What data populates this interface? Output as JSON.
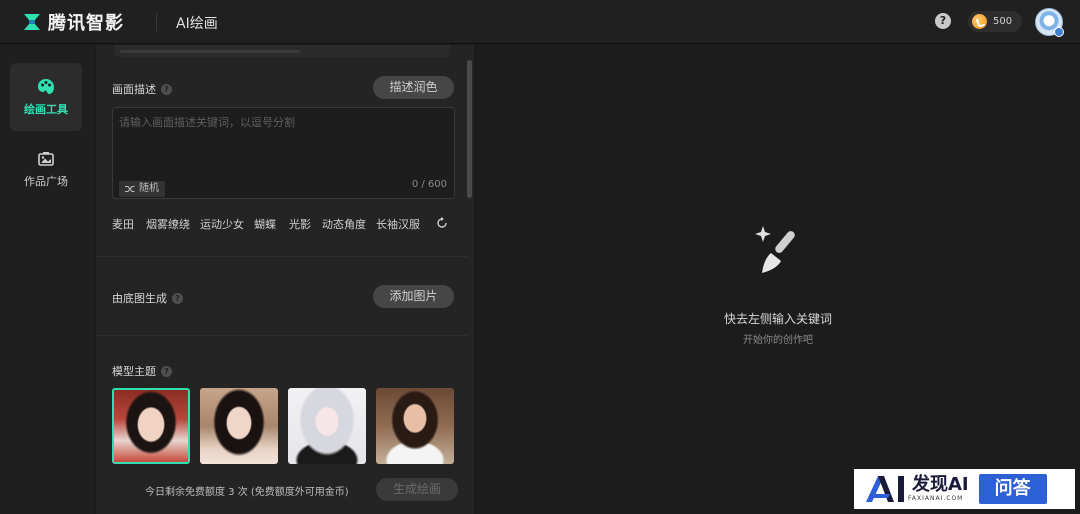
{
  "topbar": {
    "brand": "腾讯智影",
    "app_title": "AI绘画",
    "help_icon": "?",
    "coin_balance": "500",
    "icons": [
      "logo-icon",
      "help-icon",
      "coin-icon",
      "avatar"
    ]
  },
  "leftnav": {
    "items": [
      {
        "label": "绘画工具",
        "icon": "palette-icon",
        "active": true
      },
      {
        "label": "作品广场",
        "icon": "gallery-icon",
        "active": false
      }
    ]
  },
  "editor": {
    "description": {
      "label": "画面描述",
      "polish_button": "描述润色",
      "placeholder": "请输入画面描述关键词，以逗号分割",
      "random_button": "随机",
      "char_count": "0 / 600"
    },
    "tags": [
      "麦田",
      "烟雾缭绕",
      "运动少女",
      "蝴蝶",
      "光影",
      "动态角度",
      "长袖汉服"
    ],
    "base_image": {
      "label": "由底图生成",
      "add_button": "添加图片"
    },
    "model_theme": {
      "label": "模型主题",
      "thumbnails": 4,
      "selected_index": 0
    },
    "quota_text": "今日剩余免费额度 3 次 (免费额度外可用金币)",
    "generate_button": "生成绘画"
  },
  "empty_state": {
    "title": "快去左侧输入关键词",
    "subtitle": "开始你的创作吧"
  },
  "watermark": {
    "text": "发现AI",
    "sub": "FAXIANAI.COM",
    "badge": "问答"
  },
  "colors": {
    "accent": "#2fe0b0",
    "bg": "#1c1c1c",
    "panel": "#242424"
  }
}
